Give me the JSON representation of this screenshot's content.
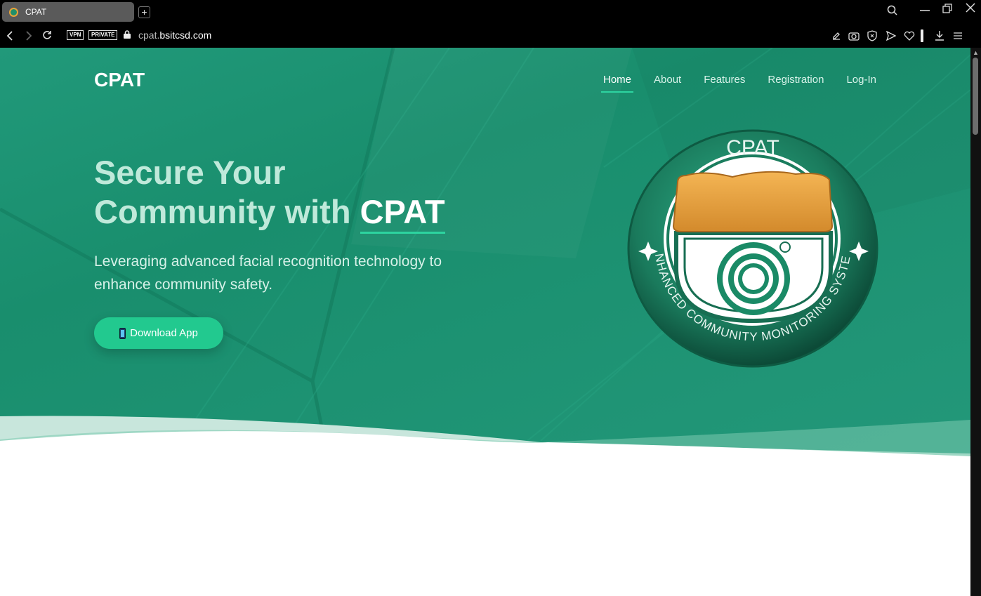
{
  "browser": {
    "tab_title": "CPAT",
    "new_tab": "+",
    "badges": {
      "vpn": "VPN",
      "private": "PRIVATE"
    },
    "url_host_dim": "cpat.",
    "url_host": "bsitcsd.com"
  },
  "site": {
    "brand": "CPAT",
    "nav": [
      {
        "label": "Home",
        "active": true
      },
      {
        "label": "About"
      },
      {
        "label": "Features"
      },
      {
        "label": "Registration"
      },
      {
        "label": "Log-In"
      }
    ],
    "hero": {
      "title_line1": "Secure Your",
      "title_line2_prefix": "Community with ",
      "title_highlight": "CPAT",
      "subtitle": "Leveraging advanced facial recognition technology to enhance community safety.",
      "cta_label": "Download App"
    },
    "logo": {
      "top_text": "CPAT",
      "ring_text": "ENHANCED COMMUNITY MONITORING SYSTEM"
    }
  },
  "colors": {
    "hero_green": "#1f9575",
    "accent": "#2dd4a0",
    "cta": "#22c98f",
    "camera_orange": "#e8a340"
  }
}
